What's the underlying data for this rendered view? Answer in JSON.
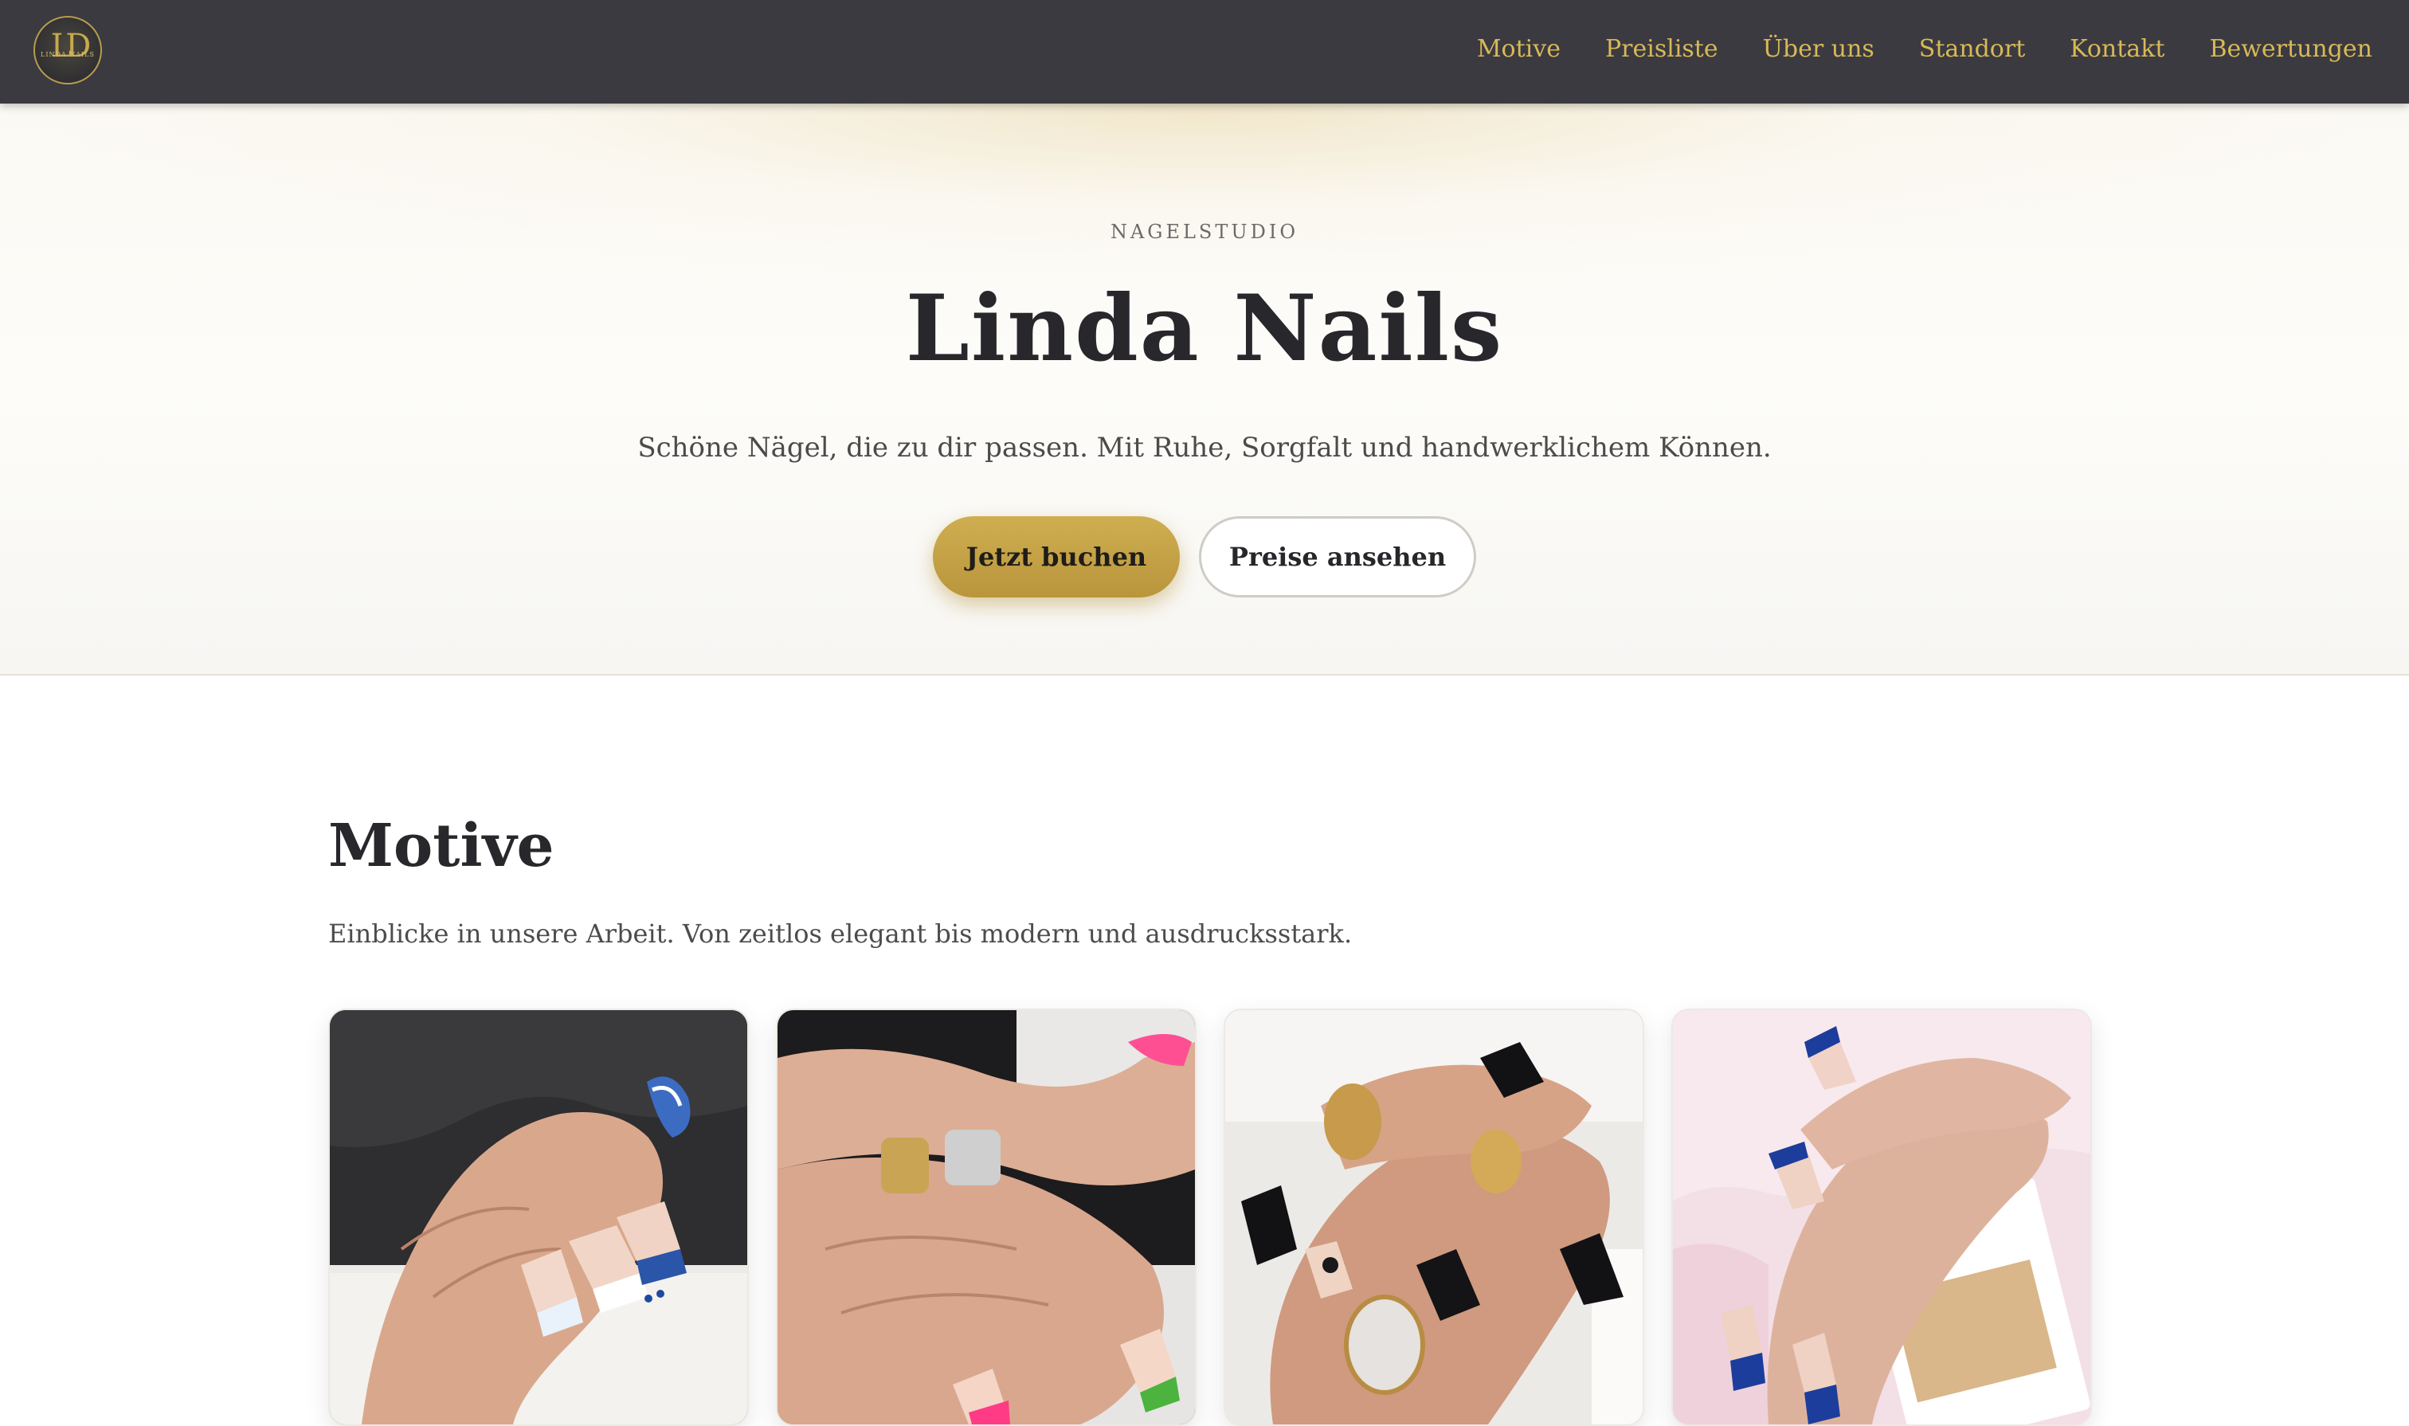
{
  "brand": {
    "logo_monogram": "LD",
    "logo_text": "LINDA NAILS"
  },
  "nav": {
    "items": [
      {
        "label": "Motive"
      },
      {
        "label": "Preisliste"
      },
      {
        "label": "Über uns"
      },
      {
        "label": "Standort"
      },
      {
        "label": "Kontakt"
      },
      {
        "label": "Bewertungen"
      }
    ]
  },
  "hero": {
    "kicker": "NAGELSTUDIO",
    "title": "Linda Nails",
    "subtitle": "Schöne Nägel, die zu dir passen. Mit Ruhe, Sorgfalt und handwerklichem Können.",
    "primary_button": "Jetzt buchen",
    "secondary_button": "Preise ansehen"
  },
  "motive": {
    "title": "Motive",
    "subtitle": "Einblicke in unsere Arbeit. Von zeitlos elegant bis modern und ausdrucksstark.",
    "cards": [
      {
        "name": "gallery-photo-blue-french"
      },
      {
        "name": "gallery-photo-colorful-tips"
      },
      {
        "name": "gallery-photo-black-gold"
      },
      {
        "name": "gallery-photo-blue-french-card"
      }
    ]
  },
  "colors": {
    "nav_bg": "#3b3a40",
    "gold": "#c9a84a",
    "nav_text": "#d8b957",
    "heading": "#28272c"
  }
}
